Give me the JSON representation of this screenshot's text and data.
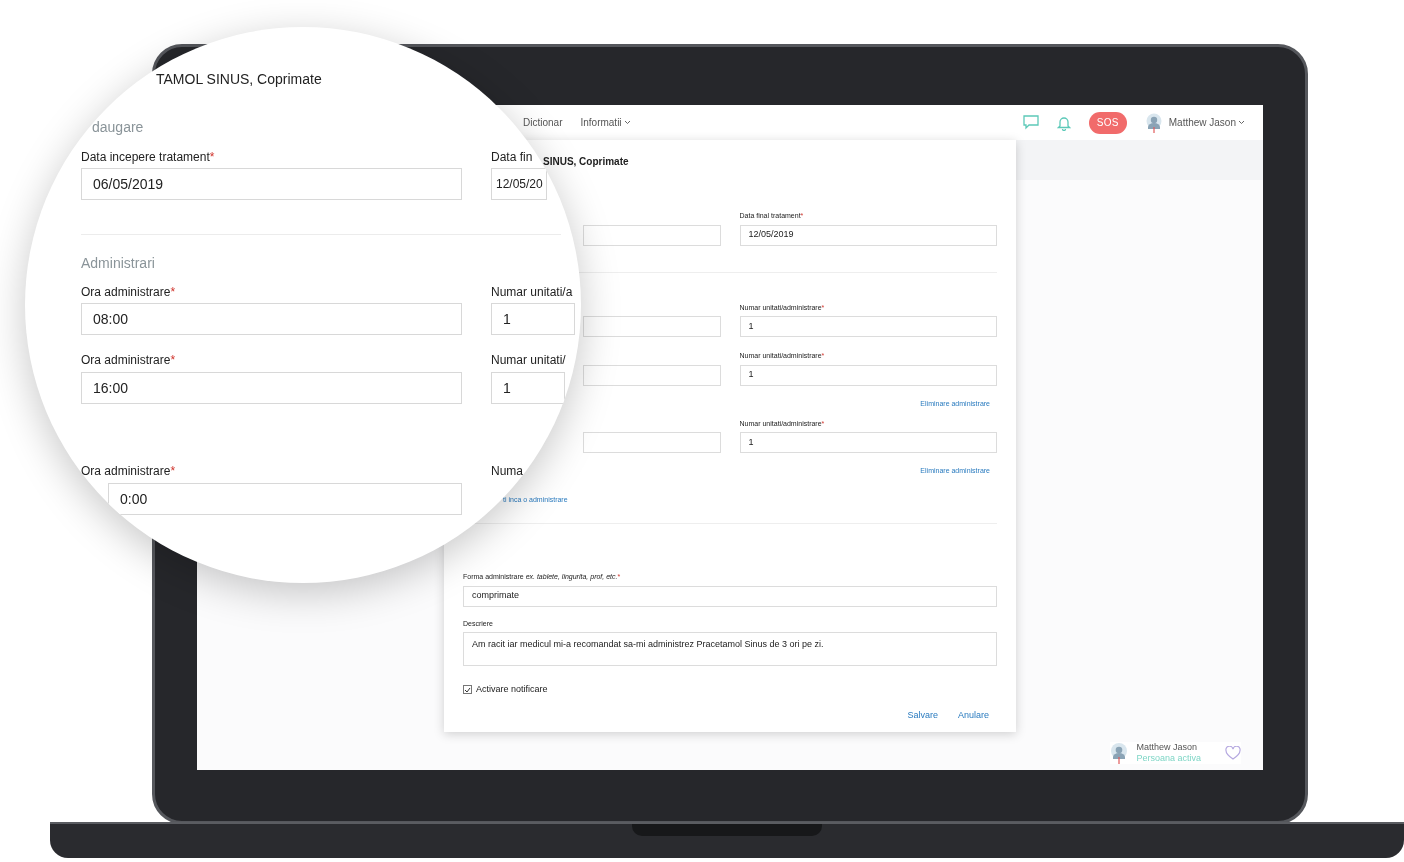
{
  "nav": {
    "links": [
      {
        "label": "Dictionar",
        "dropdown": false
      },
      {
        "label": "Informatii",
        "dropdown": true
      }
    ],
    "sos": "SOS",
    "user": {
      "name": "Matthew Jason",
      "dropdown": true
    }
  },
  "modal": {
    "title": "SINUS, Coprimate",
    "end_date": {
      "label": "Data final tratament",
      "mark": "*",
      "value": "12/05/2019"
    },
    "administrations": [
      {
        "label": "Numar unitati/administrare",
        "mark": "*",
        "value": "1"
      },
      {
        "label": "Numar unitati/administrare",
        "mark": "*",
        "value": "1",
        "remove_link": "Eliminare administrare"
      },
      {
        "label": "Numar unitati/administrare",
        "mark": "*",
        "value": "1",
        "remove_link": "Eliminare administrare"
      }
    ],
    "add_link": "ti inca o administrare",
    "form": {
      "label": "Forma administrare *ex. tablete, lingurita, prof, etc.*",
      "mark": "*",
      "value": "comprimate"
    },
    "description": {
      "label": "Descriere",
      "value": "Am racit iar medicul mi-a recomandat sa-mi administrez Pracetamol Sinus de 3 ori pe zi."
    },
    "notification": {
      "label": "Activare notificare",
      "checked": true
    },
    "buttons": [
      "Salvare",
      "Anulare"
    ]
  },
  "active_person": {
    "name": "Matthew Jason",
    "status": "Persoana activa"
  },
  "magnifier": {
    "title": "TAMOL SINUS, Coprimate",
    "section": "daugare",
    "start_date": {
      "label": "Data incepere tratament",
      "mark": "*",
      "value": "06/05/2019"
    },
    "end_date": {
      "label": "Data fin",
      "value": "12/05/20"
    },
    "section_2": "Administrari",
    "rows": [
      {
        "time_label": "Ora administrare",
        "mark": "*",
        "time": "08:00",
        "units_label": "Numar unitati/a",
        "units": "1"
      },
      {
        "time_label": "Ora administrare",
        "mark": "*",
        "time": "16:00",
        "units_label": "Numar unitati/",
        "units": "1"
      },
      {
        "time_label": "Ora administrare",
        "mark": "*",
        "time": "0:00",
        "units_label": "Numa"
      }
    ]
  }
}
